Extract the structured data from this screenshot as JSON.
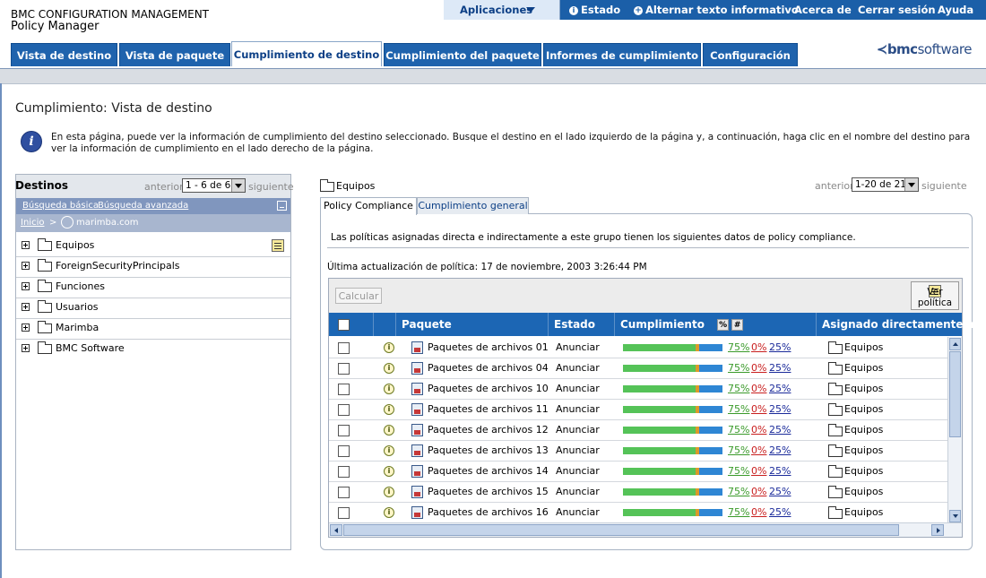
{
  "app": {
    "title_line1": "BMC CONFIGURATION MANAGEMENT",
    "title_line2": "Policy Manager",
    "logo_text": "bmc",
    "logo_text2": "software"
  },
  "topnav": {
    "apps": "Aplicaciones",
    "status": "Estado",
    "toggle": "Alternar texto informativo",
    "about": "Acerca de",
    "logout": "Cerrar sesión",
    "help": "Ayuda"
  },
  "tabs": [
    {
      "label": "Vista de destino"
    },
    {
      "label": "Vista de paquete"
    },
    {
      "label": "Cumplimiento de destino",
      "active": true
    },
    {
      "label": "Cumplimiento del paquete"
    },
    {
      "label": "Informes de cumplimiento"
    },
    {
      "label": "Configuración"
    }
  ],
  "page": {
    "title": "Cumplimiento: Vista de destino",
    "info": "En esta página, puede ver la información de cumplimiento del destino seleccionado. Busque el destino en el lado izquierdo de la página y, a continuación, haga clic en el nombre del destino para ver la información de cumplimiento en el lado derecho de la página."
  },
  "left_panel": {
    "title": "Destinos",
    "prev": "anterior",
    "next": "siguiente",
    "range": "1 - 6 de 6",
    "basic_search": "Búsqueda básica",
    "advanced_search": "Búsqueda avanzada",
    "breadcrumb_home": "Inicio",
    "breadcrumb_sep": ">",
    "breadcrumb_node": "marimba.com",
    "items": [
      {
        "label": "Equipos"
      },
      {
        "label": "ForeignSecurityPrincipals"
      },
      {
        "label": "Funciones"
      },
      {
        "label": "Usuarios"
      },
      {
        "label": "Marimba"
      },
      {
        "label": "BMC Software"
      }
    ]
  },
  "right_panel": {
    "folder_label": "Equipos",
    "prev": "anterior",
    "next": "siguiente",
    "range": "1-20 de 21",
    "tab_policy": "Policy Compliance",
    "tab_general": "Cumplimiento general",
    "description": "Las políticas asignadas directa e indirectamente a este grupo tienen los siguientes datos de policy compliance.",
    "last_update": "Última actualización de política: 17 de noviembre, 2003 3:26:44 PM",
    "calc_button": "Calcular",
    "view_policy": "Ver política",
    "columns": {
      "package": "Paquete",
      "state": "Estado",
      "compliance": "Cumplimiento",
      "pct_btn": "%",
      "num_btn": "#",
      "assigned": "Asignado directamente a"
    },
    "rows": [
      {
        "package": "Paquetes de archivos 01",
        "state": "Anunciar",
        "compliance_green": 0.75,
        "p1": "75%",
        "p2": "0%",
        "p3": "25%",
        "assigned": "Equipos"
      },
      {
        "package": "Paquetes de archivos 04",
        "state": "Anunciar",
        "compliance_green": 0.75,
        "p1": "75%",
        "p2": "0%",
        "p3": "25%",
        "assigned": "Equipos"
      },
      {
        "package": "Paquetes de archivos 10",
        "state": "Anunciar",
        "compliance_green": 0.75,
        "p1": "75%",
        "p2": "0%",
        "p3": "25%",
        "assigned": "Equipos"
      },
      {
        "package": "Paquetes de archivos 11",
        "state": "Anunciar",
        "compliance_green": 0.75,
        "p1": "75%",
        "p2": "0%",
        "p3": "25%",
        "assigned": "Equipos"
      },
      {
        "package": "Paquetes de archivos 12",
        "state": "Anunciar",
        "compliance_green": 0.75,
        "p1": "75%",
        "p2": "0%",
        "p3": "25%",
        "assigned": "Equipos"
      },
      {
        "package": "Paquetes de archivos 13",
        "state": "Anunciar",
        "compliance_green": 0.75,
        "p1": "75%",
        "p2": "0%",
        "p3": "25%",
        "assigned": "Equipos"
      },
      {
        "package": "Paquetes de archivos 14",
        "state": "Anunciar",
        "compliance_green": 0.75,
        "p1": "75%",
        "p2": "0%",
        "p3": "25%",
        "assigned": "Equipos"
      },
      {
        "package": "Paquetes de archivos 15",
        "state": "Anunciar",
        "compliance_green": 0.75,
        "p1": "75%",
        "p2": "0%",
        "p3": "25%",
        "assigned": "Equipos"
      },
      {
        "package": "Paquetes de archivos 16",
        "state": "Anunciar",
        "compliance_green": 0.75,
        "p1": "75%",
        "p2": "0%",
        "p3": "25%",
        "assigned": "Equipos"
      }
    ]
  },
  "colors": {
    "nav_blue": "#1b5fa8",
    "tab_blue": "#1f63ad",
    "header_blue": "#1c66b4",
    "bar_green": "#55c358",
    "bar_blue": "#2e86d4",
    "pct_green": "#3a9a2a",
    "pct_red": "#c81e1e",
    "pct_blue": "#1a2a9a"
  },
  "icons": {
    "info": "info-icon",
    "folder": "folder-icon",
    "expand": "plus-icon",
    "note": "note-icon",
    "package": "package-icon",
    "row_info": "info-circle-icon"
  }
}
